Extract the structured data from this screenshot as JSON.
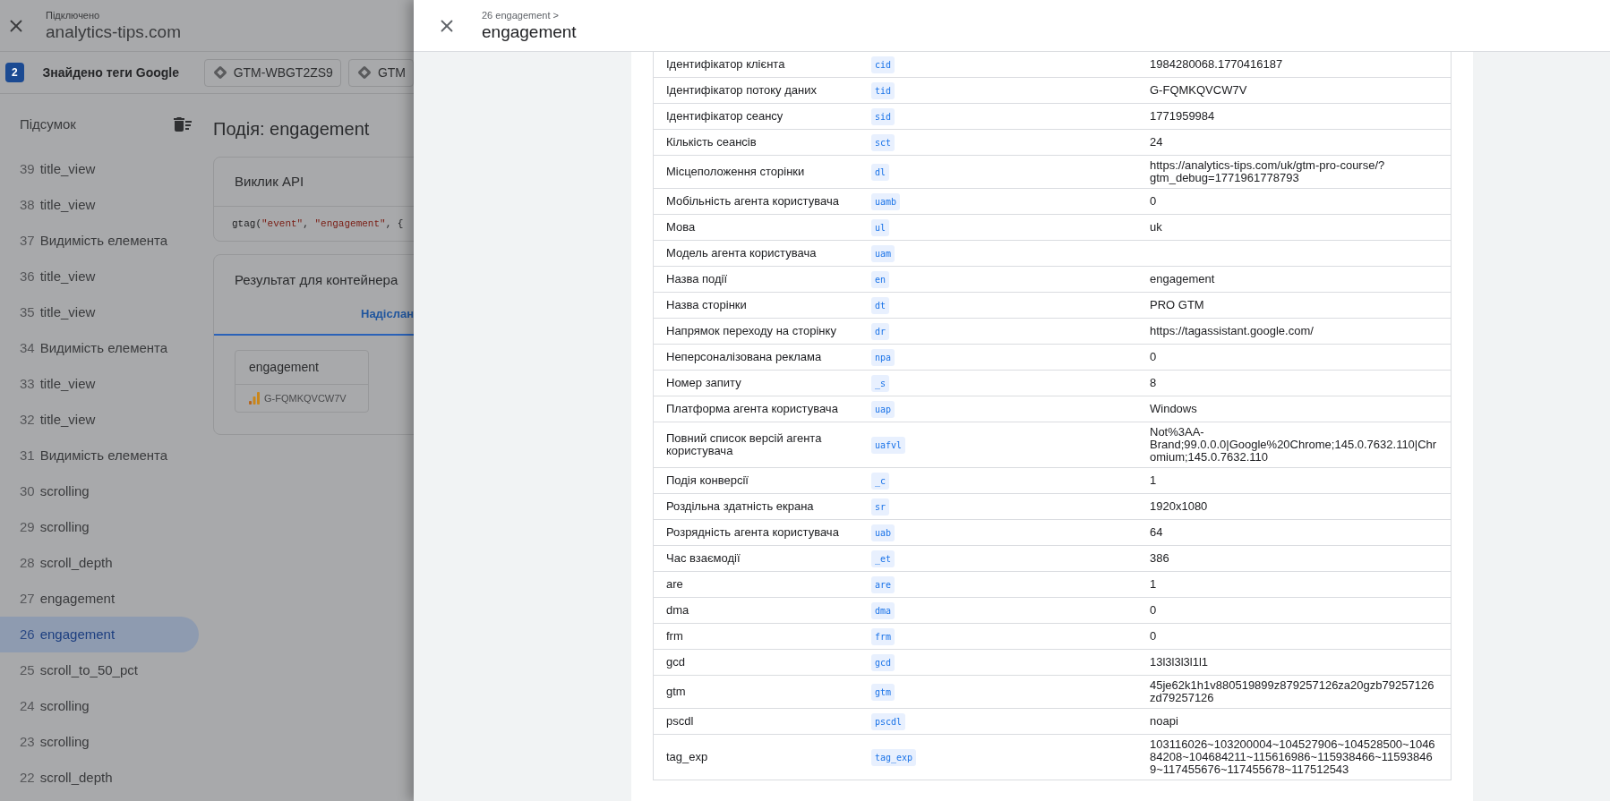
{
  "connection": {
    "status": "Підключено",
    "domain": "analytics-tips.com"
  },
  "tag_bar": {
    "count": "2",
    "label": "Знайдено теги Google",
    "containers": [
      "GTM-WBGT2ZS9",
      "GTM"
    ]
  },
  "sidebar": {
    "title": "Підсумок",
    "items": [
      {
        "number": "39",
        "label": "title_view",
        "selected": false
      },
      {
        "number": "38",
        "label": "title_view",
        "selected": false
      },
      {
        "number": "37",
        "label": "Видимість елемента",
        "selected": false
      },
      {
        "number": "36",
        "label": "title_view",
        "selected": false
      },
      {
        "number": "35",
        "label": "title_view",
        "selected": false
      },
      {
        "number": "34",
        "label": "Видимість елемента",
        "selected": false
      },
      {
        "number": "33",
        "label": "title_view",
        "selected": false
      },
      {
        "number": "32",
        "label": "title_view",
        "selected": false
      },
      {
        "number": "31",
        "label": "Видимість елемента",
        "selected": false
      },
      {
        "number": "30",
        "label": "scrolling",
        "selected": false
      },
      {
        "number": "29",
        "label": "scrolling",
        "selected": false
      },
      {
        "number": "28",
        "label": "scroll_depth",
        "selected": false
      },
      {
        "number": "27",
        "label": "engagement",
        "selected": false
      },
      {
        "number": "26",
        "label": "engagement",
        "selected": true
      },
      {
        "number": "25",
        "label": "scroll_to_50_pct",
        "selected": false
      },
      {
        "number": "24",
        "label": "scrolling",
        "selected": false
      },
      {
        "number": "23",
        "label": "scrolling",
        "selected": false
      },
      {
        "number": "22",
        "label": "scroll_depth",
        "selected": false
      }
    ]
  },
  "event": {
    "title": "Подія: engagement",
    "api_call": {
      "title": "Виклик API",
      "code": [
        {
          "kind": "plain",
          "text": "gtag("
        },
        {
          "kind": "string",
          "text": "\"event\""
        },
        {
          "kind": "plain",
          "text": ", "
        },
        {
          "kind": "string",
          "text": "\"engagement\""
        },
        {
          "kind": "plain",
          "text": ", {"
        }
      ]
    },
    "result": {
      "title": "Результат для контейнера",
      "tabs": [
        {
          "label": "Надіслан",
          "selected": true
        }
      ],
      "tag": {
        "name": "engagement",
        "id": "G-FQMKQVCW7V"
      }
    }
  },
  "panel": {
    "breadcrumb": "26 engagement >",
    "title": "engagement",
    "parameters": [
      {
        "label": "Ідентифікатор клієнта",
        "key": "cid",
        "value": "1984280068.1770416187"
      },
      {
        "label": "Ідентифікатор потоку даних",
        "key": "tid",
        "value": "G-FQMKQVCW7V"
      },
      {
        "label": "Ідентифікатор сеансу",
        "key": "sid",
        "value": "1771959984"
      },
      {
        "label": "Кількість сеансів",
        "key": "sct",
        "value": "24"
      },
      {
        "label": "Місцеположення сторінки",
        "key": "dl",
        "value": "https://analytics-tips.com/uk/gtm-pro-course/?gtm_debug=1771961778793"
      },
      {
        "label": "Мобільність агента користувача",
        "key": "uamb",
        "value": "0"
      },
      {
        "label": "Мова",
        "key": "ul",
        "value": "uk"
      },
      {
        "label": "Модель агента користувача",
        "key": "uam"
      },
      {
        "label": "Назва події",
        "key": "en",
        "value": "engagement"
      },
      {
        "label": "Назва сторінки",
        "key": "dt",
        "value": "PRO GTM"
      },
      {
        "label": "Напрямок переходу на сторінку",
        "key": "dr",
        "value": "https://tagassistant.google.com/"
      },
      {
        "label": "Неперсоналізована реклама",
        "key": "npa",
        "value": "0"
      },
      {
        "label": "Номер запиту",
        "key": "_s",
        "value": "8"
      },
      {
        "label": "Платформа агента користувача",
        "key": "uap",
        "value": "Windows"
      },
      {
        "label": "Повний список версій агента користувача",
        "key": "uafvl",
        "value": "Not%3AA-Brand;99.0.0.0|Google%20Chrome;145.0.7632.110|Chromium;145.0.7632.110"
      },
      {
        "label": "Подія конверсії",
        "key": "_c",
        "value": "1"
      },
      {
        "label": "Роздільна здатність екрана",
        "key": "sr",
        "value": "1920x1080"
      },
      {
        "label": "Розрядність агента користувача",
        "key": "uab",
        "value": "64"
      },
      {
        "label": "Час взаємодії",
        "key": "_et",
        "value": "386"
      },
      {
        "label": "are",
        "key": "are",
        "value": "1"
      },
      {
        "label": "dma",
        "key": "dma",
        "value": "0"
      },
      {
        "label": "frm",
        "key": "frm",
        "value": "0"
      },
      {
        "label": "gcd",
        "key": "gcd",
        "value": "13l3l3l3l1l1"
      },
      {
        "label": "gtm",
        "key": "gtm",
        "value": "45je62k1h1v880519899z879257126za20gzb79257126zd79257126"
      },
      {
        "label": "pscdl",
        "key": "pscdl",
        "value": "noapi"
      },
      {
        "label": "tag_exp",
        "key": "tag_exp",
        "value": "103116026~103200004~104527906~104528500~104684208~104684211~115616986~115938466~115938469~117455676~117455678~117512543"
      }
    ]
  }
}
